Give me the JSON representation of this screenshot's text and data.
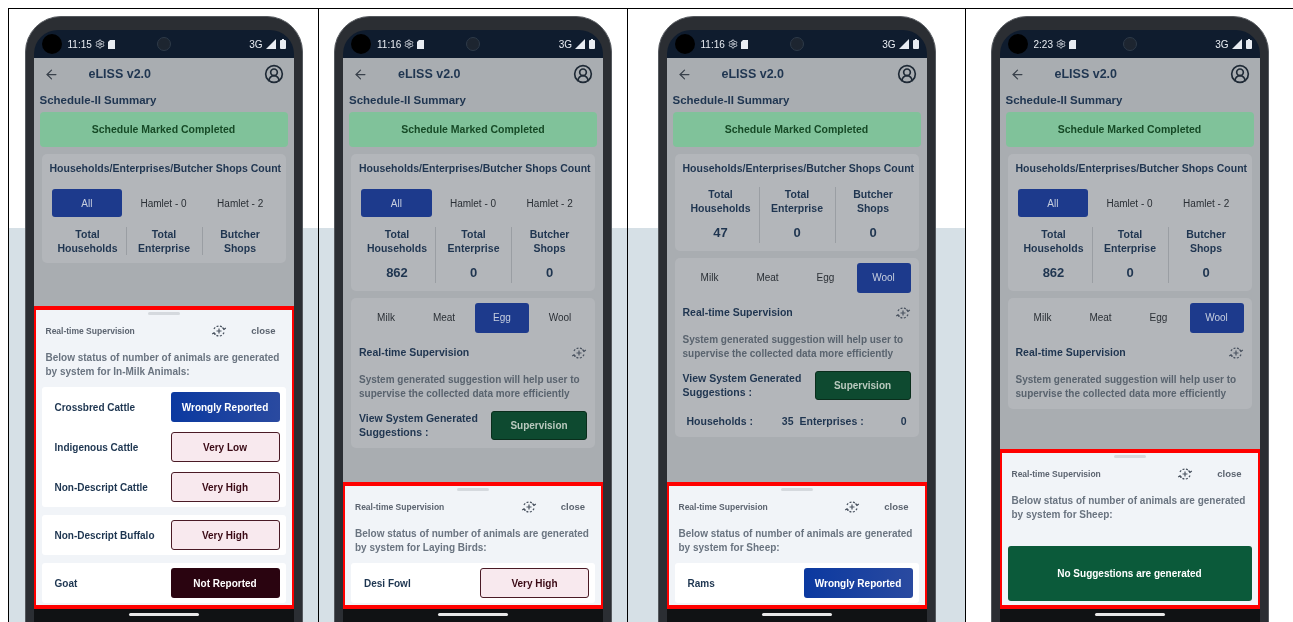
{
  "phones": [
    {
      "status_bar": {
        "time": "11:15",
        "network": "3G"
      },
      "app_bar": {
        "title": "eLISS v2.0"
      },
      "page_title": "Schedule-II Summary",
      "banner": "Schedule Marked Completed",
      "count_card": {
        "title": "Households/Enterprises/Butcher Shops Count",
        "hamlet_tabs": [
          {
            "label": "All",
            "selected": true
          },
          {
            "label": "Hamlet - 0",
            "selected": false
          },
          {
            "label": "Hamlet - 2",
            "selected": false
          }
        ],
        "stats": [
          {
            "label": "Total Households"
          },
          {
            "label": "Total Enterprise"
          },
          {
            "label": "Butcher Shops"
          }
        ]
      },
      "sheet": {
        "title": "Real-time Supervision",
        "close": "close",
        "description": "Below status of number of animals are generated by system for In-Milk Animals:",
        "groups": [
          {
            "rows": [
              {
                "animal": "Crossbred Cattle",
                "status": "Wrongly Reported",
                "kind": "wrong"
              },
              {
                "animal": "Indigenous Cattle",
                "status": "Very Low",
                "kind": "flag"
              },
              {
                "animal": "Non-Descript Cattle",
                "status": "Very High",
                "kind": "flag"
              }
            ]
          },
          {
            "rows": [
              {
                "animal": "Non-Descript Buffalo",
                "status": "Very High",
                "kind": "flag"
              }
            ]
          },
          {
            "rows": [
              {
                "animal": "Goat",
                "status": "Not Reported",
                "kind": "missing"
              }
            ]
          }
        ]
      }
    },
    {
      "status_bar": {
        "time": "11:16",
        "network": "3G"
      },
      "app_bar": {
        "title": "eLISS v2.0"
      },
      "page_title": "Schedule-II Summary",
      "banner": "Schedule Marked Completed",
      "count_card": {
        "title": "Households/Enterprises/Butcher Shops Count",
        "hamlet_tabs": [
          {
            "label": "All",
            "selected": true
          },
          {
            "label": "Hamlet - 0",
            "selected": false
          },
          {
            "label": "Hamlet - 2",
            "selected": false
          }
        ],
        "stats": [
          {
            "label": "Total Households",
            "value": "862"
          },
          {
            "label": "Total Enterprise",
            "value": "0"
          },
          {
            "label": "Butcher Shops",
            "value": "0"
          }
        ]
      },
      "product_card": {
        "tabs": [
          {
            "label": "Milk",
            "selected": false
          },
          {
            "label": "Meat",
            "selected": false
          },
          {
            "label": "Egg",
            "selected": true
          },
          {
            "label": "Wool",
            "selected": false
          }
        ],
        "heading": "Real-time Supervision",
        "description": "System generated suggestion will help user to supervise the collected data more efficiently",
        "suggestions_label": "View System Generated Suggestions :",
        "button": "Supervision"
      },
      "sheet": {
        "title": "Real-time Supervision",
        "close": "close",
        "description": "Below status of number of animals are generated by system for Laying Birds:",
        "groups": [
          {
            "rows": [
              {
                "animal": "Desi Fowl",
                "status": "Very High",
                "kind": "flag"
              }
            ]
          }
        ]
      }
    },
    {
      "status_bar": {
        "time": "11:16",
        "network": "3G"
      },
      "app_bar": {
        "title": "eLISS v2.0"
      },
      "page_title": "Schedule-II Summary",
      "banner": "Schedule Marked Completed",
      "count_card": {
        "title": "Households/Enterprises/Butcher Shops Count",
        "stats": [
          {
            "label": "Total Households",
            "value": "47"
          },
          {
            "label": "Total Enterprise",
            "value": "0"
          },
          {
            "label": "Butcher Shops",
            "value": "0"
          }
        ]
      },
      "product_card": {
        "tabs": [
          {
            "label": "Milk",
            "selected": false
          },
          {
            "label": "Meat",
            "selected": false
          },
          {
            "label": "Egg",
            "selected": false
          },
          {
            "label": "Wool",
            "selected": true
          }
        ],
        "heading": "Real-time Supervision",
        "description": "System generated suggestion will help user to supervise the collected data more efficiently",
        "suggestions_label": "View System Generated Suggestions :",
        "button": "Supervision",
        "totals": [
          {
            "label": "Households :",
            "value": "35"
          },
          {
            "label": "Enterprises :",
            "value": "0"
          }
        ]
      },
      "sheet": {
        "title": "Real-time Supervision",
        "close": "close",
        "description": "Below status of number of animals are generated by system for Sheep:",
        "groups": [
          {
            "rows": [
              {
                "animal": "Rams",
                "status": "Wrongly Reported",
                "kind": "wrong"
              }
            ]
          }
        ]
      }
    },
    {
      "status_bar": {
        "time": "2:23",
        "network": "3G"
      },
      "app_bar": {
        "title": "eLISS v2.0"
      },
      "page_title": "Schedule-II Summary",
      "banner": "Schedule Marked Completed",
      "count_card": {
        "title": "Households/Enterprises/Butcher Shops Count",
        "hamlet_tabs": [
          {
            "label": "All",
            "selected": true
          },
          {
            "label": "Hamlet - 0",
            "selected": false
          },
          {
            "label": "Hamlet - 2",
            "selected": false
          }
        ],
        "stats": [
          {
            "label": "Total Households",
            "value": "862"
          },
          {
            "label": "Total Enterprise",
            "value": "0"
          },
          {
            "label": "Butcher Shops",
            "value": "0"
          }
        ]
      },
      "product_card": {
        "tabs": [
          {
            "label": "Milk",
            "selected": false
          },
          {
            "label": "Meat",
            "selected": false
          },
          {
            "label": "Egg",
            "selected": false
          },
          {
            "label": "Wool",
            "selected": true
          }
        ],
        "heading": "Real-time Supervision",
        "description": "System generated suggestion will help user to supervise the collected data more efficiently"
      },
      "sheet": {
        "title": "Real-time Supervision",
        "close": "close",
        "description": "Below status of number of animals are generated by system for Sheep:",
        "message": "No Suggestions are generated"
      }
    }
  ]
}
